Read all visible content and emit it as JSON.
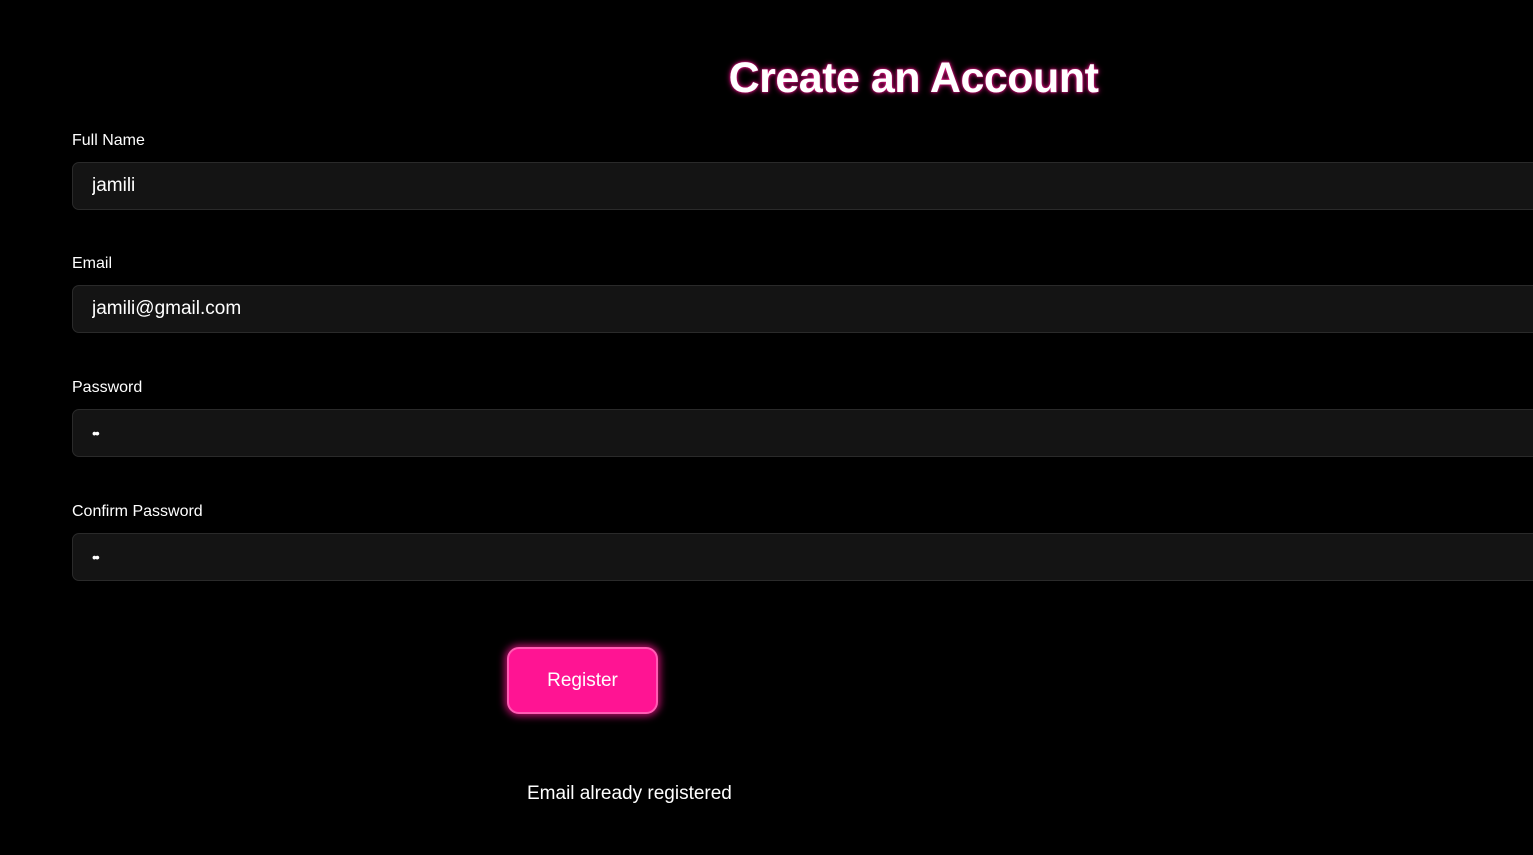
{
  "page": {
    "title": "Create an Account"
  },
  "form": {
    "full_name": {
      "label": "Full Name",
      "value": "jamili"
    },
    "email": {
      "label": "Email",
      "value": "jamili@gmail.com"
    },
    "password": {
      "label": "Password",
      "value": "ab"
    },
    "confirm_password": {
      "label": "Confirm Password",
      "value": "ab"
    },
    "register_label": "Register"
  },
  "status": {
    "message": "Email already registered"
  },
  "colors": {
    "background": "#000000",
    "accent": "#ff1493",
    "input_background": "#141414"
  }
}
